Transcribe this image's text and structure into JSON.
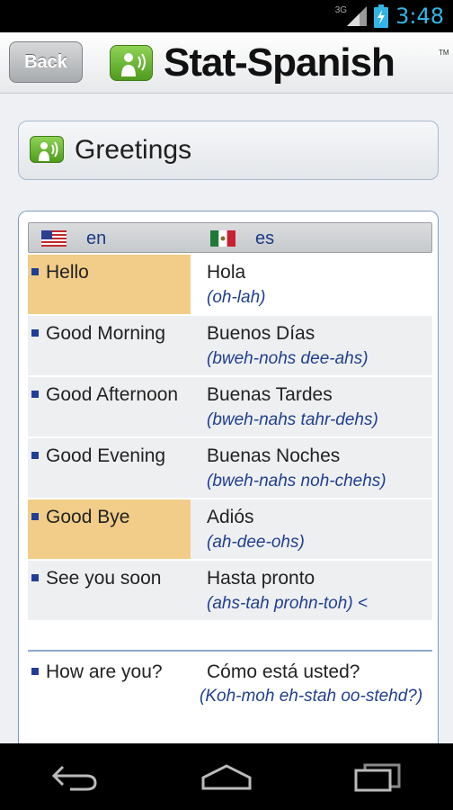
{
  "status_bar": {
    "time": "3:48",
    "network": "3G"
  },
  "header": {
    "back_label": "Back",
    "app_title": "Stat-Spanish",
    "trademark": "TM"
  },
  "section": {
    "title": "Greetings"
  },
  "table": {
    "lang_en": "en",
    "lang_es": "es",
    "rows": [
      {
        "en": "Hello",
        "es": "Hola",
        "pron": "(oh-lah)"
      },
      {
        "en": "Good Morning",
        "es": "Buenos Días",
        "pron": "(bweh-nohs dee-ahs)"
      },
      {
        "en": "Good Afternoon",
        "es": "Buenas Tardes",
        "pron": "(bweh-nahs tahr-dehs)"
      },
      {
        "en": "Good Evening",
        "es": "Buenas Noches",
        "pron": "(bweh-nahs noh-chehs)"
      },
      {
        "en": "Good Bye",
        "es": "Adiós",
        "pron": "(ah-dee-ohs)"
      },
      {
        "en": "See you soon",
        "es": "Hasta pronto",
        "pron": "(ahs-tah prohn-toh) <"
      },
      {
        "en": "How are you?",
        "es": "Cómo está usted?",
        "pron": "(Koh-moh eh-stah oo-stehd?)"
      }
    ]
  },
  "colors": {
    "highlight": "#f1cd89",
    "pron_text": "#1f3f8f",
    "accent_blue": "#33b5e5"
  },
  "icons": [
    "signal-icon",
    "battery-icon",
    "app-logo-icon",
    "us-flag-icon",
    "mexico-flag-icon",
    "back-nav-icon",
    "home-nav-icon",
    "recent-apps-icon"
  ]
}
